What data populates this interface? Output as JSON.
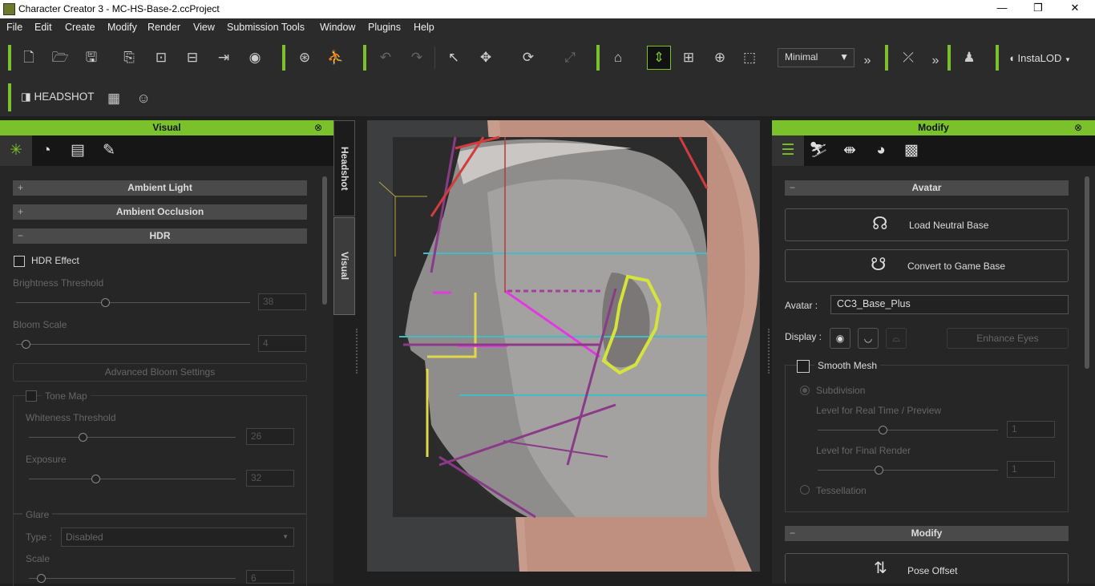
{
  "window": {
    "title": "Character Creator 3 - MC-HS-Base-2.ccProject",
    "minimize": "—",
    "restore": "❐",
    "close": "✕"
  },
  "menu": [
    "File",
    "Edit",
    "Create",
    "Modify",
    "Render",
    "View",
    "Submission Tools",
    "Window",
    "Plugins",
    "Help"
  ],
  "toolbar": {
    "view_mode": "Minimal",
    "instalod": "InstaLOD",
    "headshot": "HEADSHOT"
  },
  "left_panel": {
    "title": "Visual",
    "sections": {
      "ambient_light": "Ambient Light",
      "ambient_occlusion": "Ambient Occlusion",
      "hdr": "HDR"
    },
    "hdr_effect": "HDR Effect",
    "brightness_threshold": {
      "label": "Brightness Threshold",
      "value": "38",
      "fraction": 0.38
    },
    "bloom_scale": {
      "label": "Bloom Scale",
      "value": "4",
      "fraction": 0.04
    },
    "advanced_bloom": "Advanced Bloom Settings",
    "tone_map": "Tone Map",
    "whiteness_threshold": {
      "label": "Whiteness Threshold",
      "value": "26",
      "fraction": 0.26
    },
    "exposure": {
      "label": "Exposure",
      "value": "32",
      "fraction": 0.32
    },
    "glare": "Glare",
    "glare_type_label": "Type :",
    "glare_type_value": "Disabled",
    "scale": {
      "label": "Scale",
      "value": "6",
      "fraction": 0.06
    }
  },
  "side_tabs": {
    "headshot": "Headshot",
    "visual": "Visual"
  },
  "right_panel": {
    "title": "Modify",
    "avatar_section": "Avatar",
    "load_neutral_base": "Load Neutral Base",
    "convert_game_base": "Convert to Game Base",
    "avatar_label": "Avatar :",
    "avatar_value": "CC3_Base_Plus",
    "display_label": "Display :",
    "enhance_eyes": "Enhance Eyes",
    "smooth_mesh": "Smooth Mesh",
    "subdivision": "Subdivision",
    "level_realtime": {
      "label": "Level for Real Time / Preview",
      "value": "1"
    },
    "level_final": {
      "label": "Level for Final Render",
      "value": "1"
    },
    "tessellation": "Tessellation",
    "modify_section": "Modify",
    "pose_offset": "Pose Offset"
  },
  "colors": {
    "accent": "#7ac12b",
    "panel": "#262626"
  }
}
